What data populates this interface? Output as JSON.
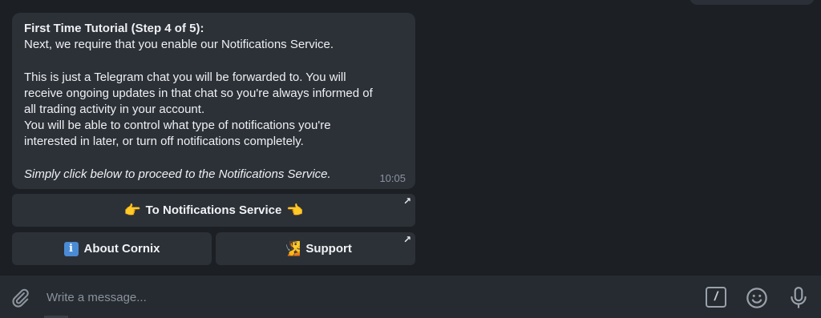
{
  "message": {
    "lines": [
      "First Time Tutorial (Step 4 of 5):",
      "Next, we require that you enable our Notifications Service.",
      "",
      "This is just a Telegram chat you will be forwarded to. You will",
      "receive ongoing updates in that chat so you're always informed of",
      "all trading activity in your account.",
      "You will be able to control what type of notifications you're",
      "interested in later, or turn off notifications completely.",
      "",
      "Simply click below to proceed to the Notifications Service."
    ],
    "time": "10:05"
  },
  "buttons": {
    "notifications": {
      "label": "To Notifications Service",
      "emoji_left": "👉",
      "emoji_right": "👈",
      "link_arrow": "↗"
    },
    "about": {
      "label": "About Cornix",
      "emoji": "i"
    },
    "support": {
      "label": "Support",
      "emoji": "🧏",
      "link_arrow": "↗"
    }
  },
  "input": {
    "placeholder": "Write a message...",
    "value": ""
  },
  "icons": {
    "attach": "paperclip-icon",
    "commands": "slash-command-icon",
    "emoji": "smile-icon",
    "voice": "microphone-icon"
  },
  "colors": {
    "chat_bg": "#1c1f24",
    "bubble_bg": "#2c3138",
    "input_bg": "#262b31",
    "time_text": "#8a939e",
    "placeholder_text": "#8b929b"
  }
}
